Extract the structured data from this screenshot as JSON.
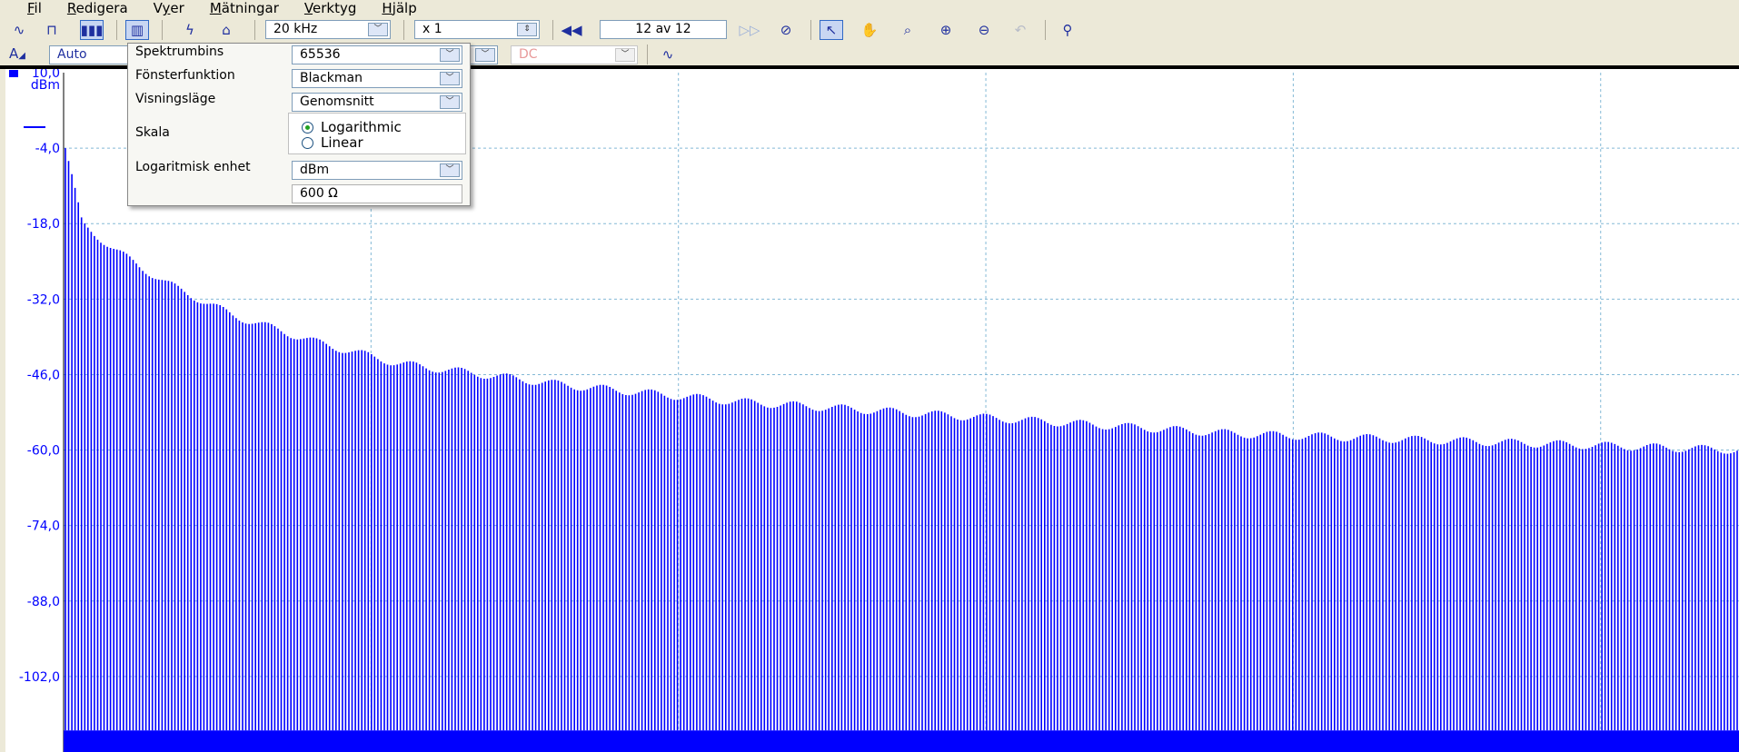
{
  "menu": [
    {
      "pre": "",
      "u": "F",
      "post": "il"
    },
    {
      "pre": "",
      "u": "R",
      "post": "edigera"
    },
    {
      "pre": "V",
      "u": "y",
      "post": "er"
    },
    {
      "pre": "",
      "u": "M",
      "post": "ätningar"
    },
    {
      "pre": "",
      "u": "V",
      "post": "erktyg"
    },
    {
      "pre": "",
      "u": "H",
      "post": "jälp"
    }
  ],
  "toolbar": {
    "timebase": "20 kHz",
    "multiplier": "x 1",
    "page": "12",
    "page_sep": "av",
    "page_total": "12"
  },
  "channel": {
    "label": "A",
    "range": "Auto",
    "coupling": "DC"
  },
  "popup": {
    "spectrum_bins_label": "Spektrumbins",
    "spectrum_bins_value": "65536",
    "window_label": "Fönsterfunktion",
    "window_value": "Blackman",
    "display_mode_label": "Visningsläge",
    "display_mode_value": "Genomsnitt",
    "scale_label": "Skala",
    "scale_options": [
      "Logarithmic",
      "Linear"
    ],
    "scale_selected": 0,
    "log_unit_label": "Logaritmisk enhet",
    "log_unit_value": "dBm",
    "impedance_value": "600 Ω"
  },
  "colors": {
    "trace": "#0000ff",
    "axis_text": "#0000ff",
    "grid": "#84b9d6"
  },
  "chart_data": {
    "type": "line",
    "title": "",
    "xlabel": "",
    "ylabel": "dBm",
    "y_ticks": [
      "10,0",
      "-4,0",
      "-18,0",
      "-32,0",
      "-46,0",
      "-60,0",
      "-74,0",
      "-88,0",
      "-102,0"
    ],
    "ylim": [
      -116,
      10
    ],
    "grid": true,
    "series": [
      {
        "x_fraction": [
          0.0,
          0.01,
          0.03,
          0.06,
          0.1,
          0.15,
          0.2,
          0.25,
          0.3,
          0.4,
          0.5,
          0.6,
          0.7,
          0.8,
          0.9,
          1.0
        ],
        "peak_envelope": [
          -4,
          -18,
          -23,
          -29,
          -35,
          -40,
          -44,
          -46,
          -48,
          -51,
          -53,
          -55,
          -57,
          -58,
          -59,
          -60
        ],
        "noise_floor": -112
      }
    ]
  }
}
